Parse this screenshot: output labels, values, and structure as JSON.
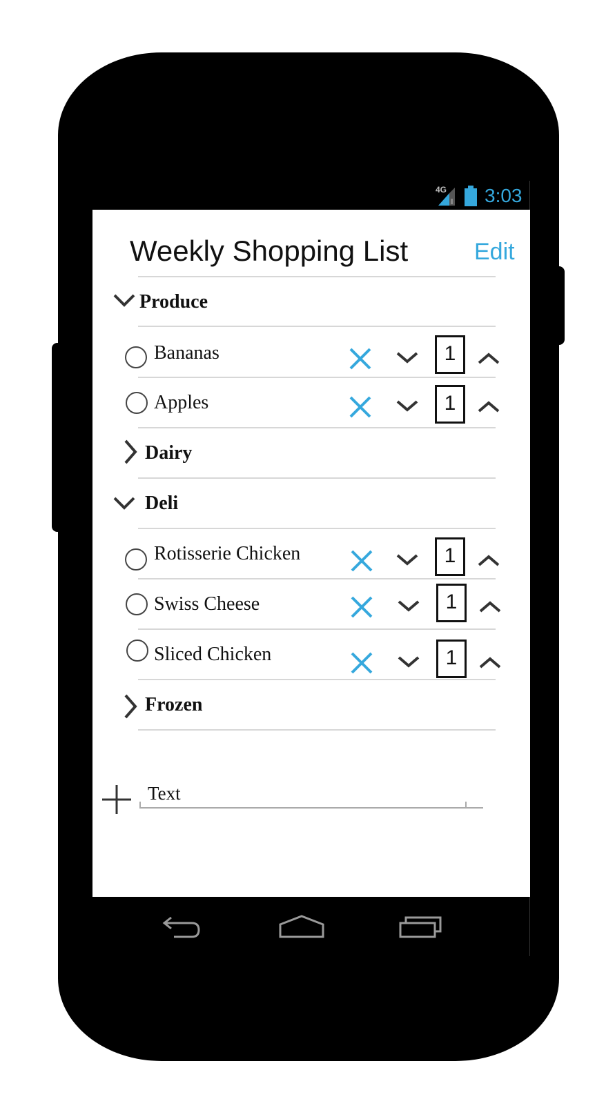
{
  "status_bar": {
    "network": "4G",
    "time": "3:03",
    "icons": [
      "signal-icon",
      "battery-icon"
    ]
  },
  "header": {
    "title": "Weekly Shopping List",
    "edit_label": "Edit"
  },
  "categories": [
    {
      "name": "Produce",
      "expanded": true,
      "items": [
        {
          "name": "Bananas",
          "quantity": "1"
        },
        {
          "name": "Apples",
          "quantity": "1"
        }
      ]
    },
    {
      "name": "Dairy",
      "expanded": false,
      "items": []
    },
    {
      "name": "Deli",
      "expanded": true,
      "items": [
        {
          "name": "Rotisserie Chicken",
          "quantity": "1"
        },
        {
          "name": "Swiss Cheese",
          "quantity": "1"
        },
        {
          "name": "Sliced Chicken",
          "quantity": "1"
        }
      ]
    },
    {
      "name": "Frozen",
      "expanded": false,
      "items": []
    }
  ],
  "add_item": {
    "value": "Text",
    "icon": "plus-icon"
  },
  "nav": {
    "icons": [
      "back-icon",
      "home-icon",
      "recents-icon"
    ]
  },
  "colors": {
    "accent": "#35a8dd",
    "text": "#111111",
    "divider": "#d7d7d7",
    "phone": "#000000"
  }
}
